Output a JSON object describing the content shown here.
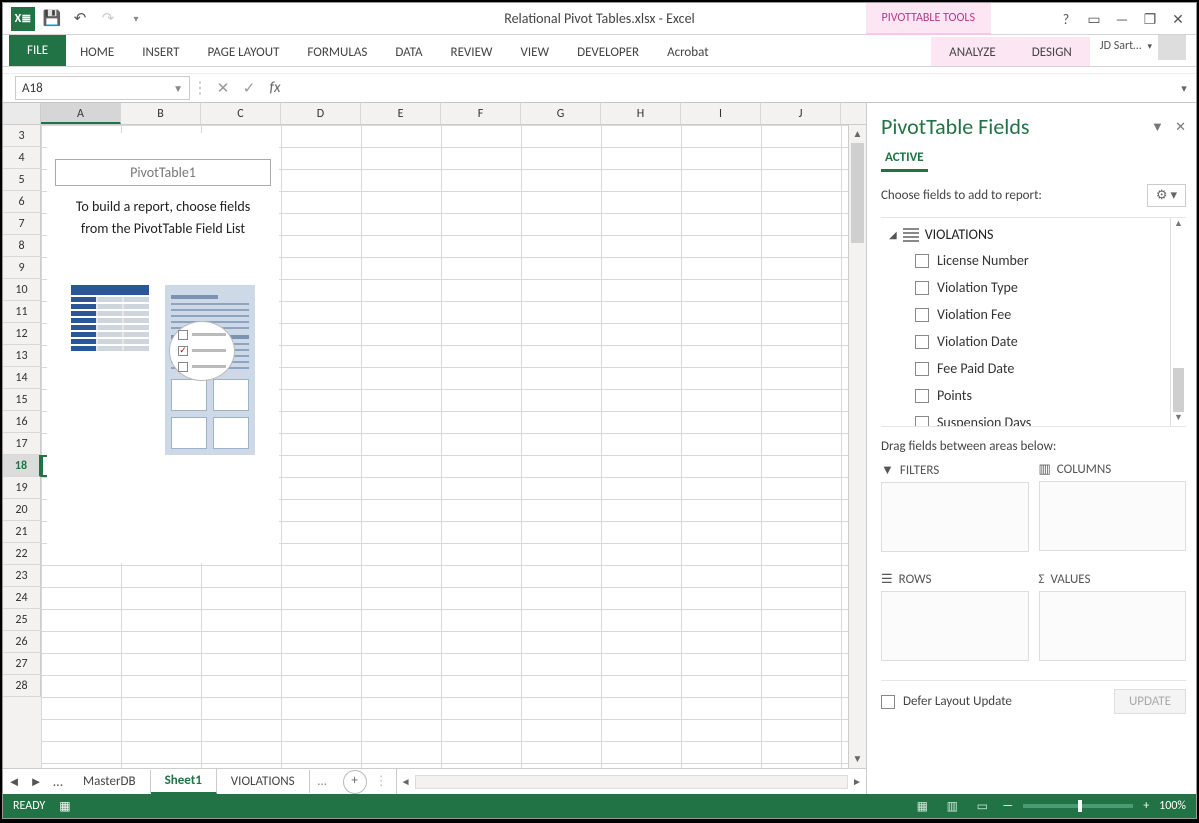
{
  "title": "Relational Pivot Tables.xlsx - Excel",
  "contextual_tools": "PIVOTTABLE TOOLS",
  "ribbon_tabs": [
    "FILE",
    "HOME",
    "INSERT",
    "PAGE LAYOUT",
    "FORMULAS",
    "DATA",
    "REVIEW",
    "VIEW",
    "DEVELOPER",
    "Acrobat"
  ],
  "context_tabs": [
    "ANALYZE",
    "DESIGN"
  ],
  "user_name": "JD Sart…",
  "name_box": "A18",
  "columns": [
    "A",
    "B",
    "C",
    "D",
    "E",
    "F",
    "G",
    "H",
    "I",
    "J"
  ],
  "rows_start": 3,
  "rows_end": 28,
  "active_row": 18,
  "pivot_placeholder": {
    "name": "PivotTable1",
    "hint_line1": "To build a report, choose fields",
    "hint_line2": "from the PivotTable Field List"
  },
  "sheet_tabs": {
    "left": "MasterDB",
    "active": "Sheet1",
    "right": "VIOLATIONS"
  },
  "pt_pane": {
    "title": "PivotTable Fields",
    "active_tab": "ACTIVE",
    "choose_label": "Choose fields to add to report:",
    "table_name": "VIOLATIONS",
    "fields": [
      "License Number",
      "Violation Type",
      "Violation Fee",
      "Violation Date",
      "Fee Paid Date",
      "Points",
      "Suspension Days"
    ],
    "drag_label": "Drag fields between areas below:",
    "areas": {
      "filters": "FILTERS",
      "columns": "COLUMNS",
      "rows": "ROWS",
      "values": "VALUES"
    },
    "defer_label": "Defer Layout Update",
    "update_label": "UPDATE"
  },
  "status": {
    "ready": "READY",
    "zoom": "100%"
  }
}
